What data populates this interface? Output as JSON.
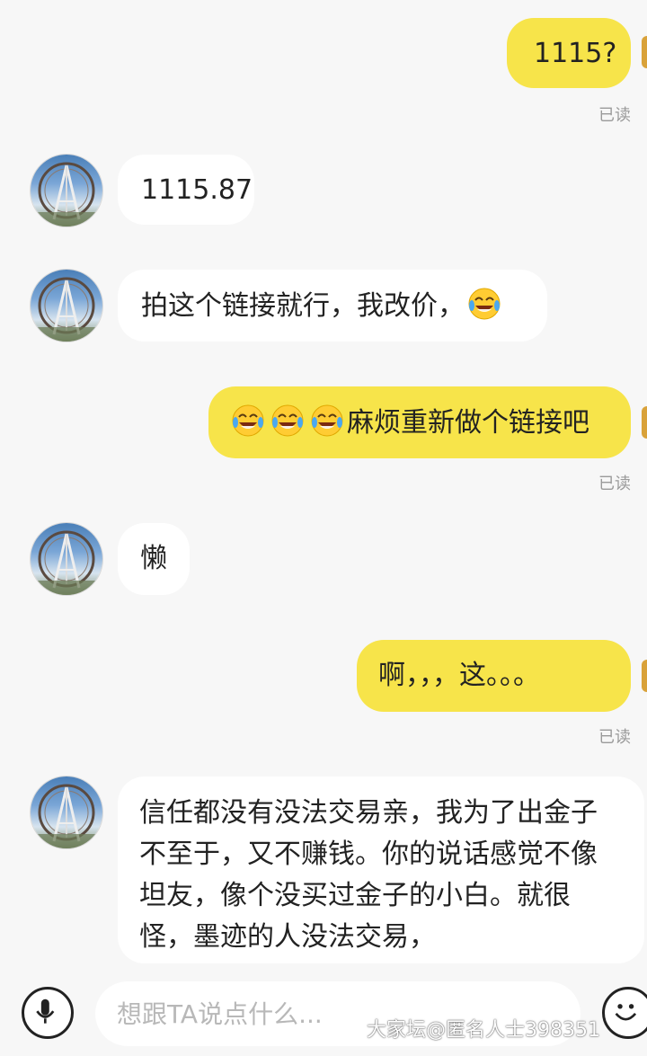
{
  "messages": [
    {
      "text": "1115?",
      "read": "已读"
    },
    {
      "text": "1115.87"
    },
    {
      "text": "拍这个链接就行，我改价，"
    },
    {
      "text": "麻烦重新做个链接吧",
      "read": "已读"
    },
    {
      "text": "懒"
    },
    {
      "text": "啊，，，这。。。",
      "read": "已读"
    },
    {
      "text": "信任都没有没法交易亲，我为了出金子不至于，又不赚钱。你的说话感觉不像坦友，像个没买过金子的小白。就很怪，墨迹的人没法交易，"
    }
  ],
  "input": {
    "placeholder": "想跟TA说点什么..."
  },
  "watermark": "大家坛@匿名人士398351",
  "colors": {
    "my_bubble": "#f7e44a",
    "their_bubble": "#ffffff",
    "background": "#f7f7f7",
    "read_text": "#9a9a9a"
  },
  "icons": {
    "emoji": "tears-of-joy-emoji",
    "mic": "microphone-icon",
    "smiley": "smiley-icon"
  }
}
